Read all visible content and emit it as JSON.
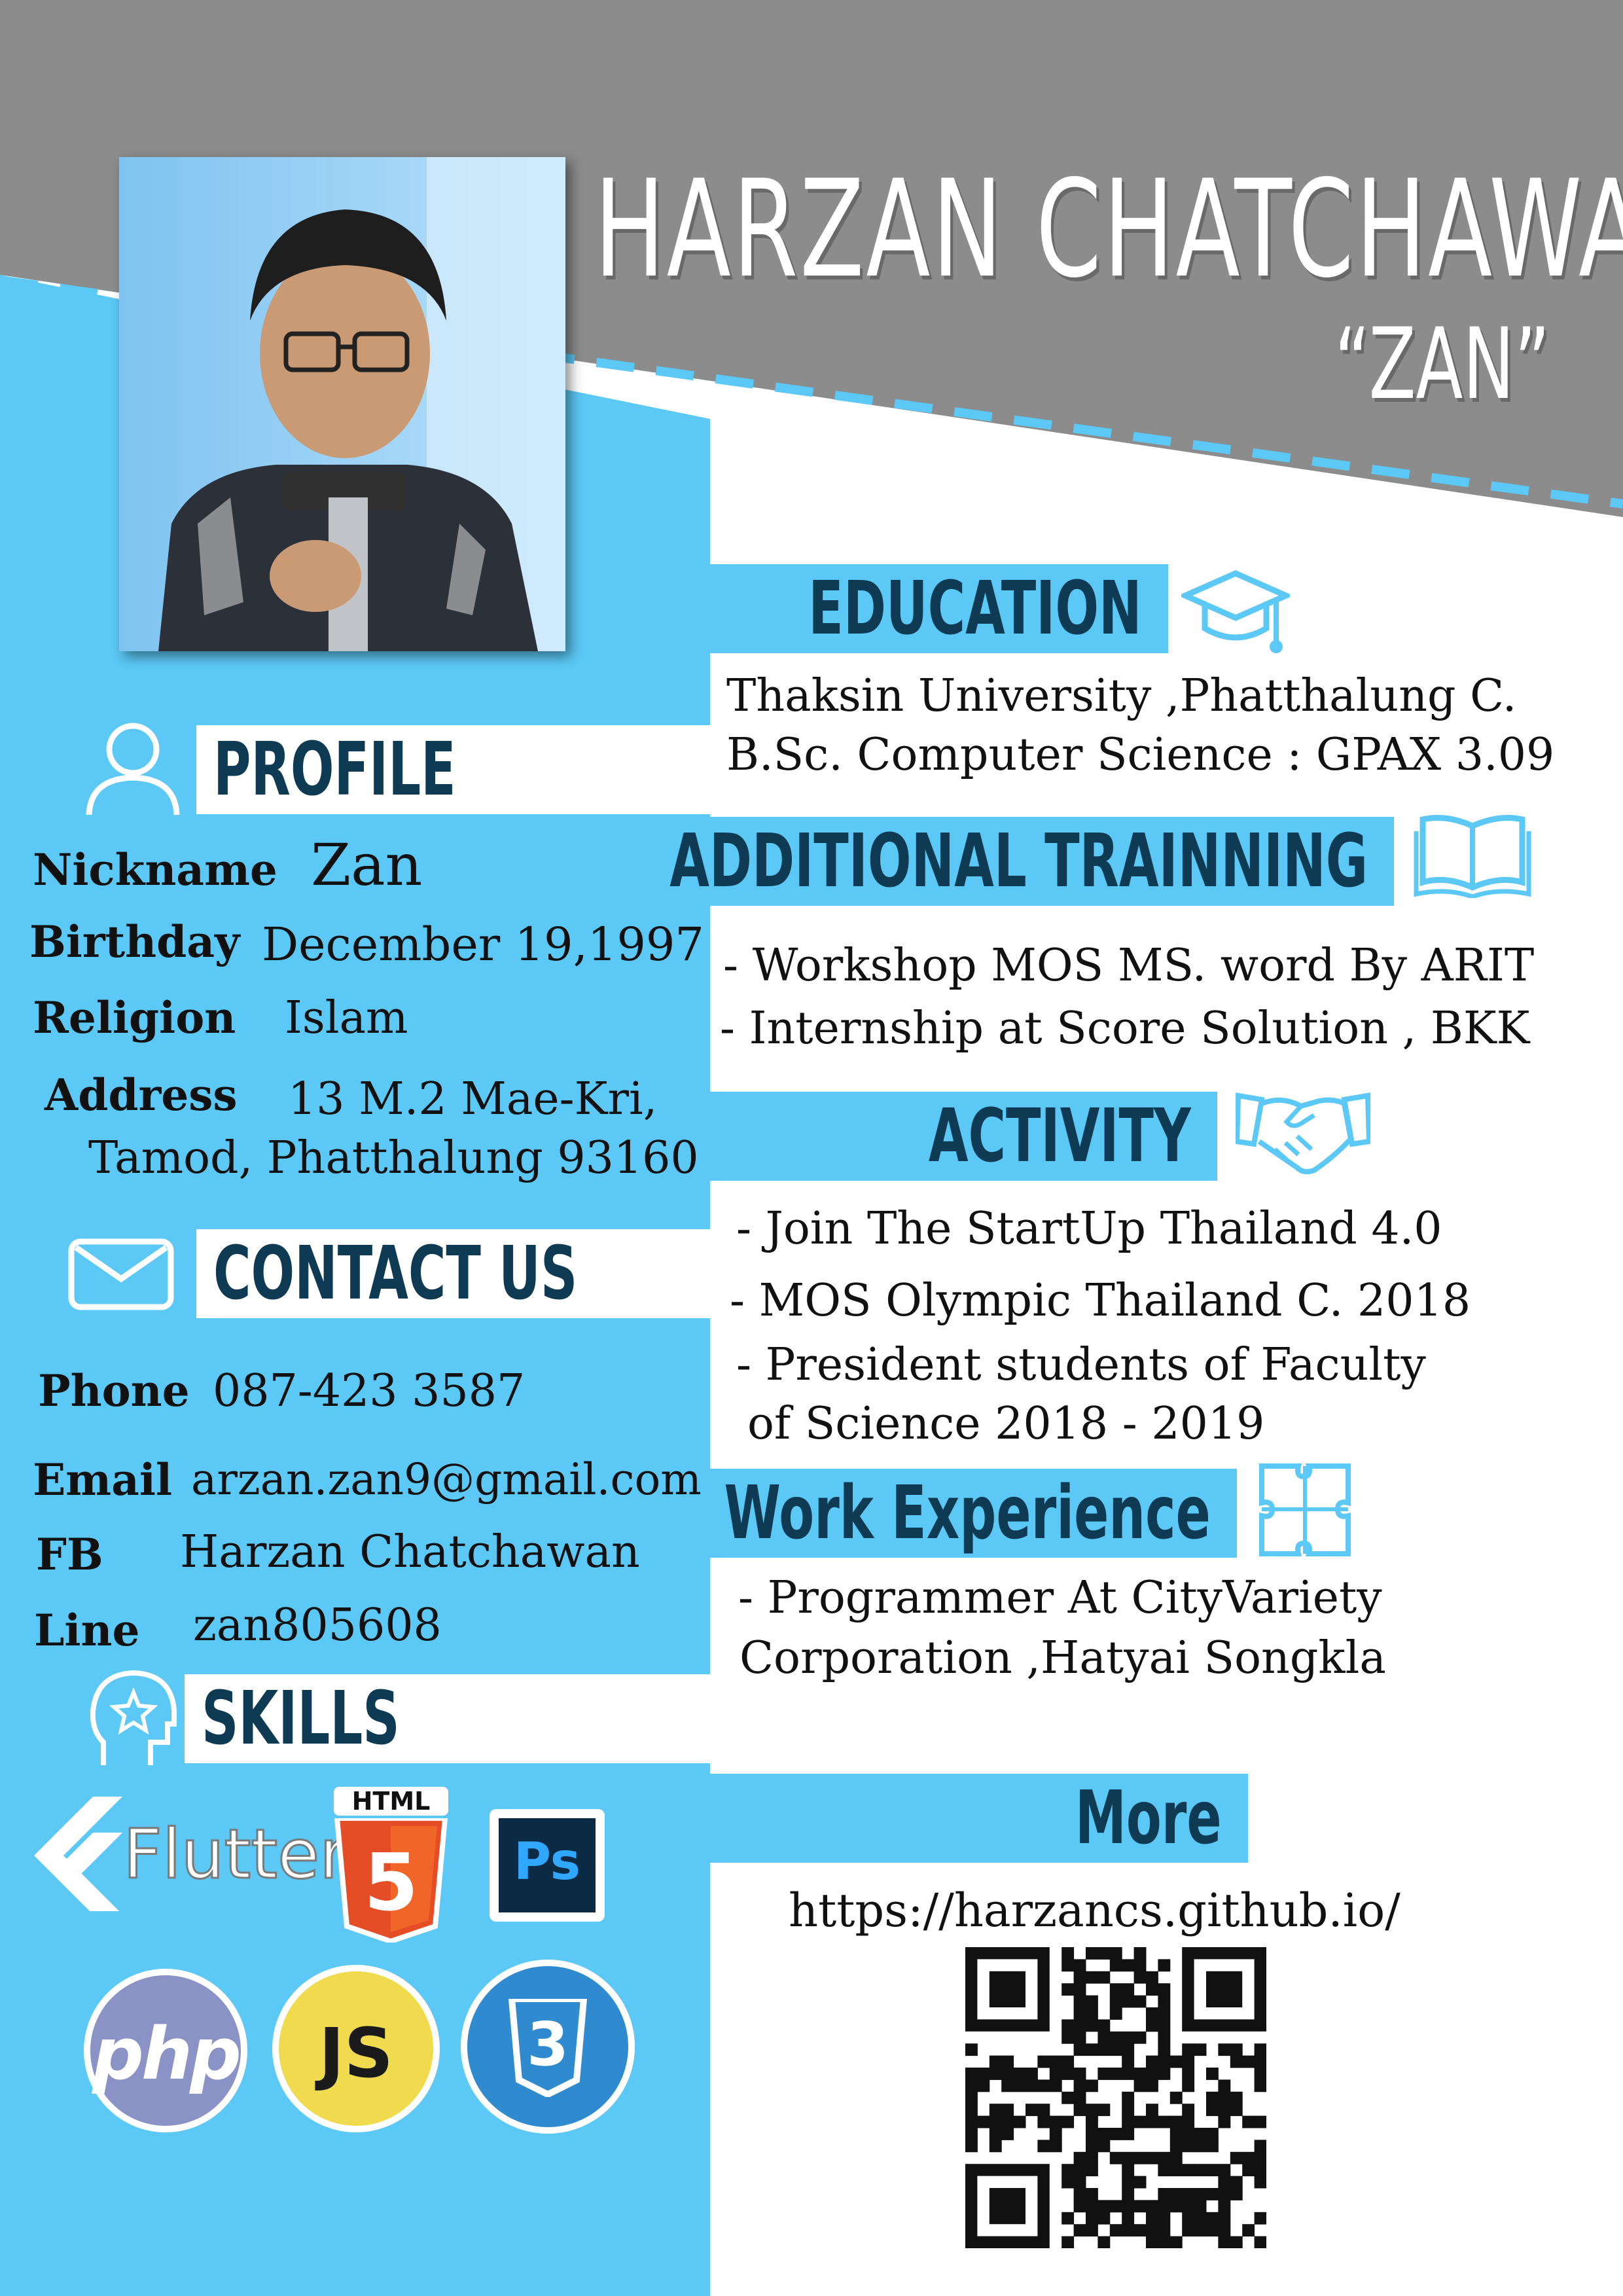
{
  "header": {
    "name": "HARZAN CHATCHAWAN",
    "nickname": "“ZAN”"
  },
  "colors": {
    "accent": "#5bc8f5",
    "header_gray": "#8c8c8c",
    "label_dark": "#0e3a53"
  },
  "profile": {
    "heading": "PROFILE",
    "nickname_label": "Nickname",
    "nickname_value": "Zan",
    "birthday_label": "Birthday",
    "birthday_value": "December 19,1997",
    "religion_label": "Religion",
    "religion_value": "Islam",
    "address_label": "Address",
    "address_line1": "13 M.2 Mae-Kri,",
    "address_line2": "Tamod, Phatthalung 93160"
  },
  "contact": {
    "heading": "CONTACT US",
    "phone_label": "Phone",
    "phone_value": "087-423 3587",
    "email_label": "Email",
    "email_value": "arzan.zan9@gmail.com",
    "fb_label": "FB",
    "fb_value": "Harzan Chatchawan",
    "line_label": "Line",
    "line_value": "zan805608"
  },
  "skills": {
    "heading": "SKILLS",
    "flutter": "Flutter",
    "html_badge": "HTML",
    "html_num": "5",
    "ps": "Ps",
    "php": "php",
    "js": "JS",
    "css_num": "3"
  },
  "education": {
    "heading": "EDUCATION",
    "line1": "Thaksin University ,Phatthalung C.",
    "line2": "B.Sc. Computer Science :  GPAX 3.09"
  },
  "training": {
    "heading": "ADDITIONAL TRAINNING",
    "items": [
      "- Workshop MOS MS. word By ARIT",
      "- Internship at Score Solution , BKK"
    ]
  },
  "activity": {
    "heading": "ACTIVITY",
    "item1": "- Join The StartUp Thailand 4.0",
    "item2": "- MOS Olympic Thailand C. 2018",
    "item3_line1": "- President students of Faculty",
    "item3_line2": "of Science 2018 - 2019"
  },
  "work": {
    "heading": "Work Experience",
    "line1": "- Programmer At CityVariety",
    "line2": "Corporation ,Hatyai Songkla"
  },
  "more": {
    "heading": "More",
    "url": "https://harzancs.github.io/"
  }
}
